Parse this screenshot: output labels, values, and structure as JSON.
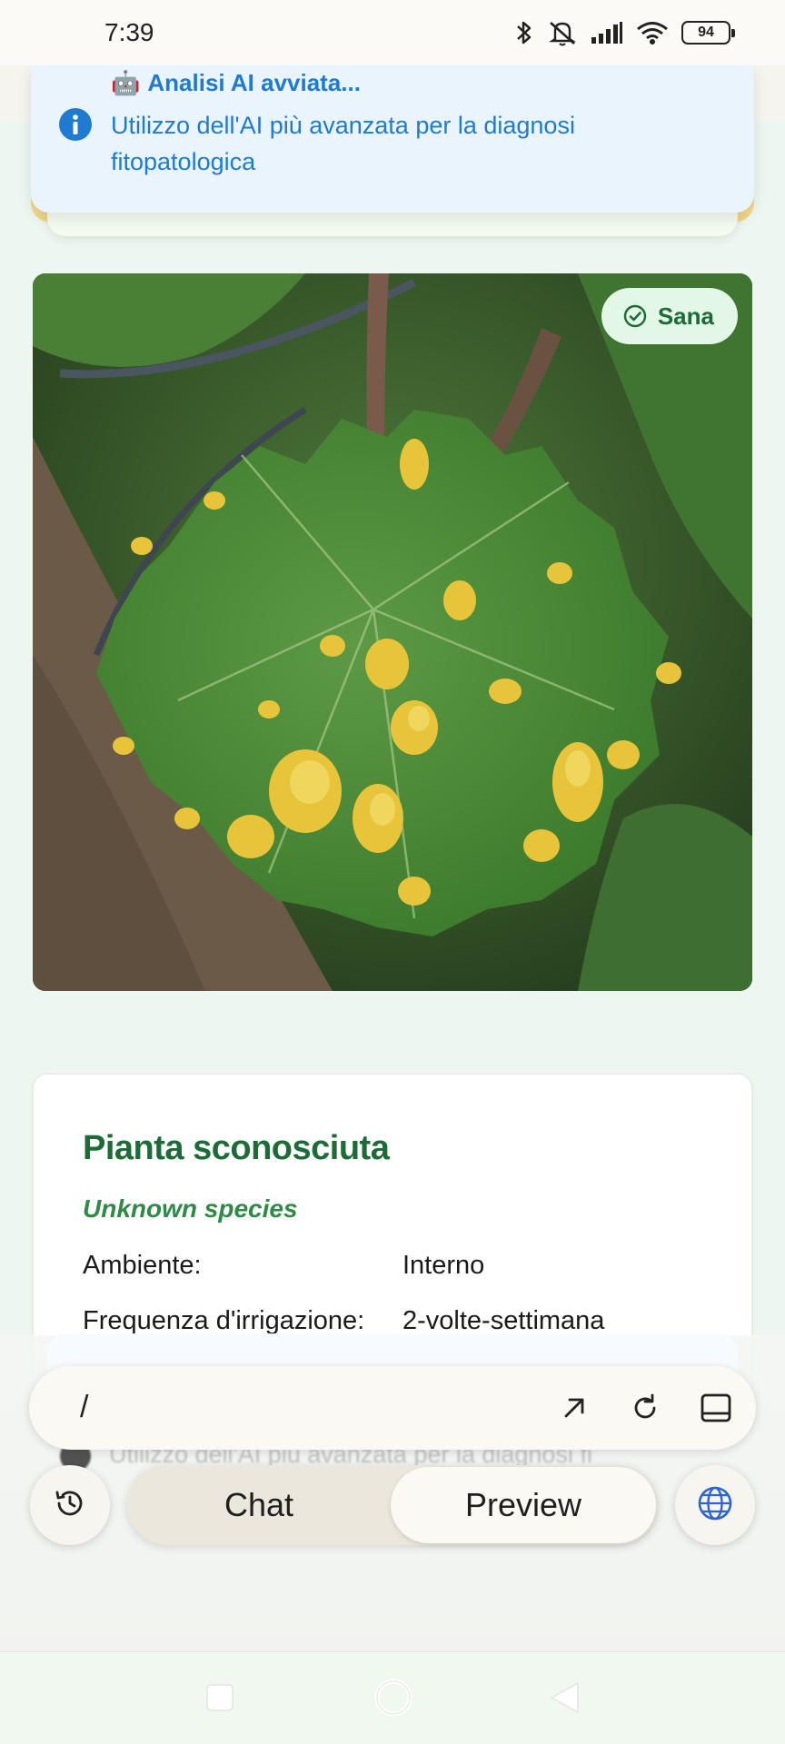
{
  "status_bar": {
    "time": "7:39",
    "battery": "94",
    "icons": [
      "bluetooth-icon",
      "mute-icon",
      "signal-icon",
      "wifi-icon",
      "battery-icon"
    ]
  },
  "toast": {
    "title": "Analisi AI avviata...",
    "title_emoji": "🤖",
    "message": "Utilizzo dell'AI più avanzata per la diagnosi fitopatologica",
    "icon": "info-icon",
    "color": "#1f7ad1"
  },
  "photo": {
    "status_chip": "Sana",
    "chip_icon": "check-circle-icon"
  },
  "plant": {
    "name": "Pianta sconosciuta",
    "species": "Unknown species",
    "rows": [
      {
        "label": "Ambiente:",
        "value": "Interno"
      },
      {
        "label": "Frequenza d'irrigazione:",
        "value": "2-volte-settimana"
      }
    ]
  },
  "ghost": {
    "text": "Utilizzo dell'AI più avanzata per la diagnosi fi"
  },
  "url_bar": {
    "path": "/",
    "icons": [
      "open-external-icon",
      "reload-icon",
      "panel-icon"
    ]
  },
  "tabs": {
    "chat": "Chat",
    "preview": "Preview",
    "active": "Preview"
  },
  "buttons": {
    "history": "history-icon",
    "language": "globe-icon"
  },
  "nav": [
    "recents-icon",
    "home-icon",
    "back-icon"
  ],
  "colors": {
    "brand_green": "#1d6b36",
    "accent_blue": "#1f7ad1"
  }
}
